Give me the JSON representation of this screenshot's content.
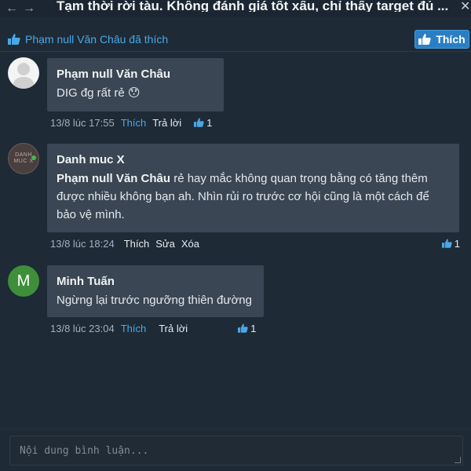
{
  "topbar": {
    "title": "Tạm thời rời tàu. Không đánh giá tốt xấu, chỉ thấy target đủ ...",
    "back_icon": "arrow-left-icon",
    "forward_icon": "arrow-right-icon",
    "close_icon": "close-icon"
  },
  "likes": {
    "text": "Phạm null Văn Châu đã thích",
    "button_label": "Thích",
    "accent": "#4aa8e6"
  },
  "comments": [
    {
      "author": "Phạm null Văn Châu",
      "mention": "",
      "text": "DIG đg rất rẻ 😯",
      "time": "13/8 lúc 17:55",
      "actions": [
        "Thích",
        "Trả lời"
      ],
      "like_count": "1"
    },
    {
      "author": "Danh muc X",
      "avatar_text": "DANH MUC X",
      "mention": "Phạm null Văn Châu",
      "text": " rẻ hay mắc không quan trọng bằng có tăng thêm được nhiều không bạn ah. Nhìn rủi ro trước cơ hội cũng là một cách để bảo vệ mình.",
      "time": "13/8 lúc 18:24",
      "actions": [
        "Thích",
        "Sửa",
        "Xóa"
      ],
      "like_count": "1"
    },
    {
      "author": "Minh Tuấn",
      "avatar_letter": "M",
      "mention": "",
      "text": "Ngừng lại trước ngưỡng thiên đường",
      "time": "13/8 lúc 23:04",
      "actions": [
        "Thích",
        "Trả lời"
      ],
      "like_count": "1"
    }
  ],
  "composer": {
    "placeholder": "Nội dung bình luận..."
  }
}
